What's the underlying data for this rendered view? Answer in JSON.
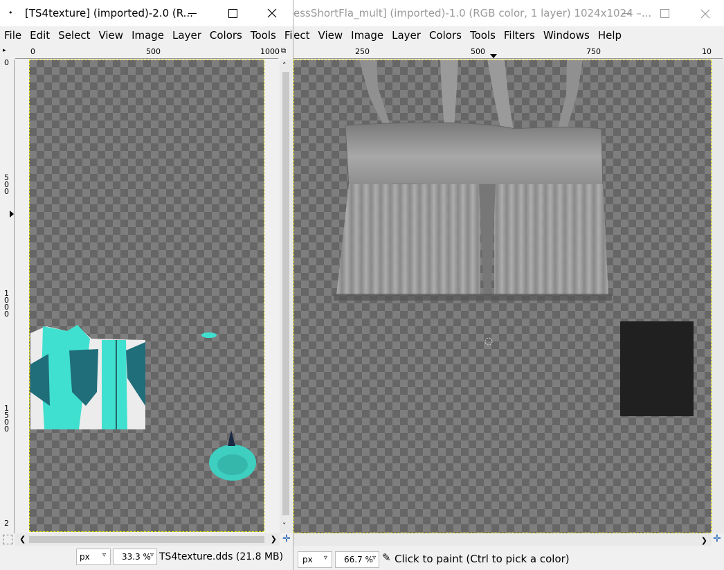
{
  "right_window": {
    "title": "essShortFla_mult] (imported)-1.0 (RGB color, 1 layer) 1024x1024 –...",
    "menu": [
      "lect",
      "View",
      "Image",
      "Layer",
      "Colors",
      "Tools",
      "Filters",
      "Windows",
      "Help"
    ],
    "ruler_labels": [
      "250",
      "500",
      "750",
      "10"
    ],
    "status": {
      "unit": "px",
      "zoom": "66.7 %",
      "message": "Click to paint (Ctrl to pick a color)"
    }
  },
  "left_window": {
    "title": "[TS4texture] (imported)-2.0 (R...",
    "menu": [
      "File",
      "Edit",
      "Select",
      "View",
      "Image",
      "Layer",
      "Colors",
      "Tools",
      "Filte"
    ],
    "ruler_labels": [
      "0",
      "500",
      "1000"
    ],
    "vruler_labels": [
      "0",
      "5\n0\n0",
      "1\n0\n0\n0",
      "1\n5\n0\n0",
      "2"
    ],
    "status": {
      "unit": "px",
      "zoom": "33.3 %",
      "file_info": "TS4texture.dds (21.8 MB)"
    }
  },
  "icons": [
    "app-icon",
    "minimize-icon",
    "maximize-icon",
    "close-icon",
    "navigate-icon",
    "paintbrush-icon",
    "chevron-down-icon"
  ]
}
